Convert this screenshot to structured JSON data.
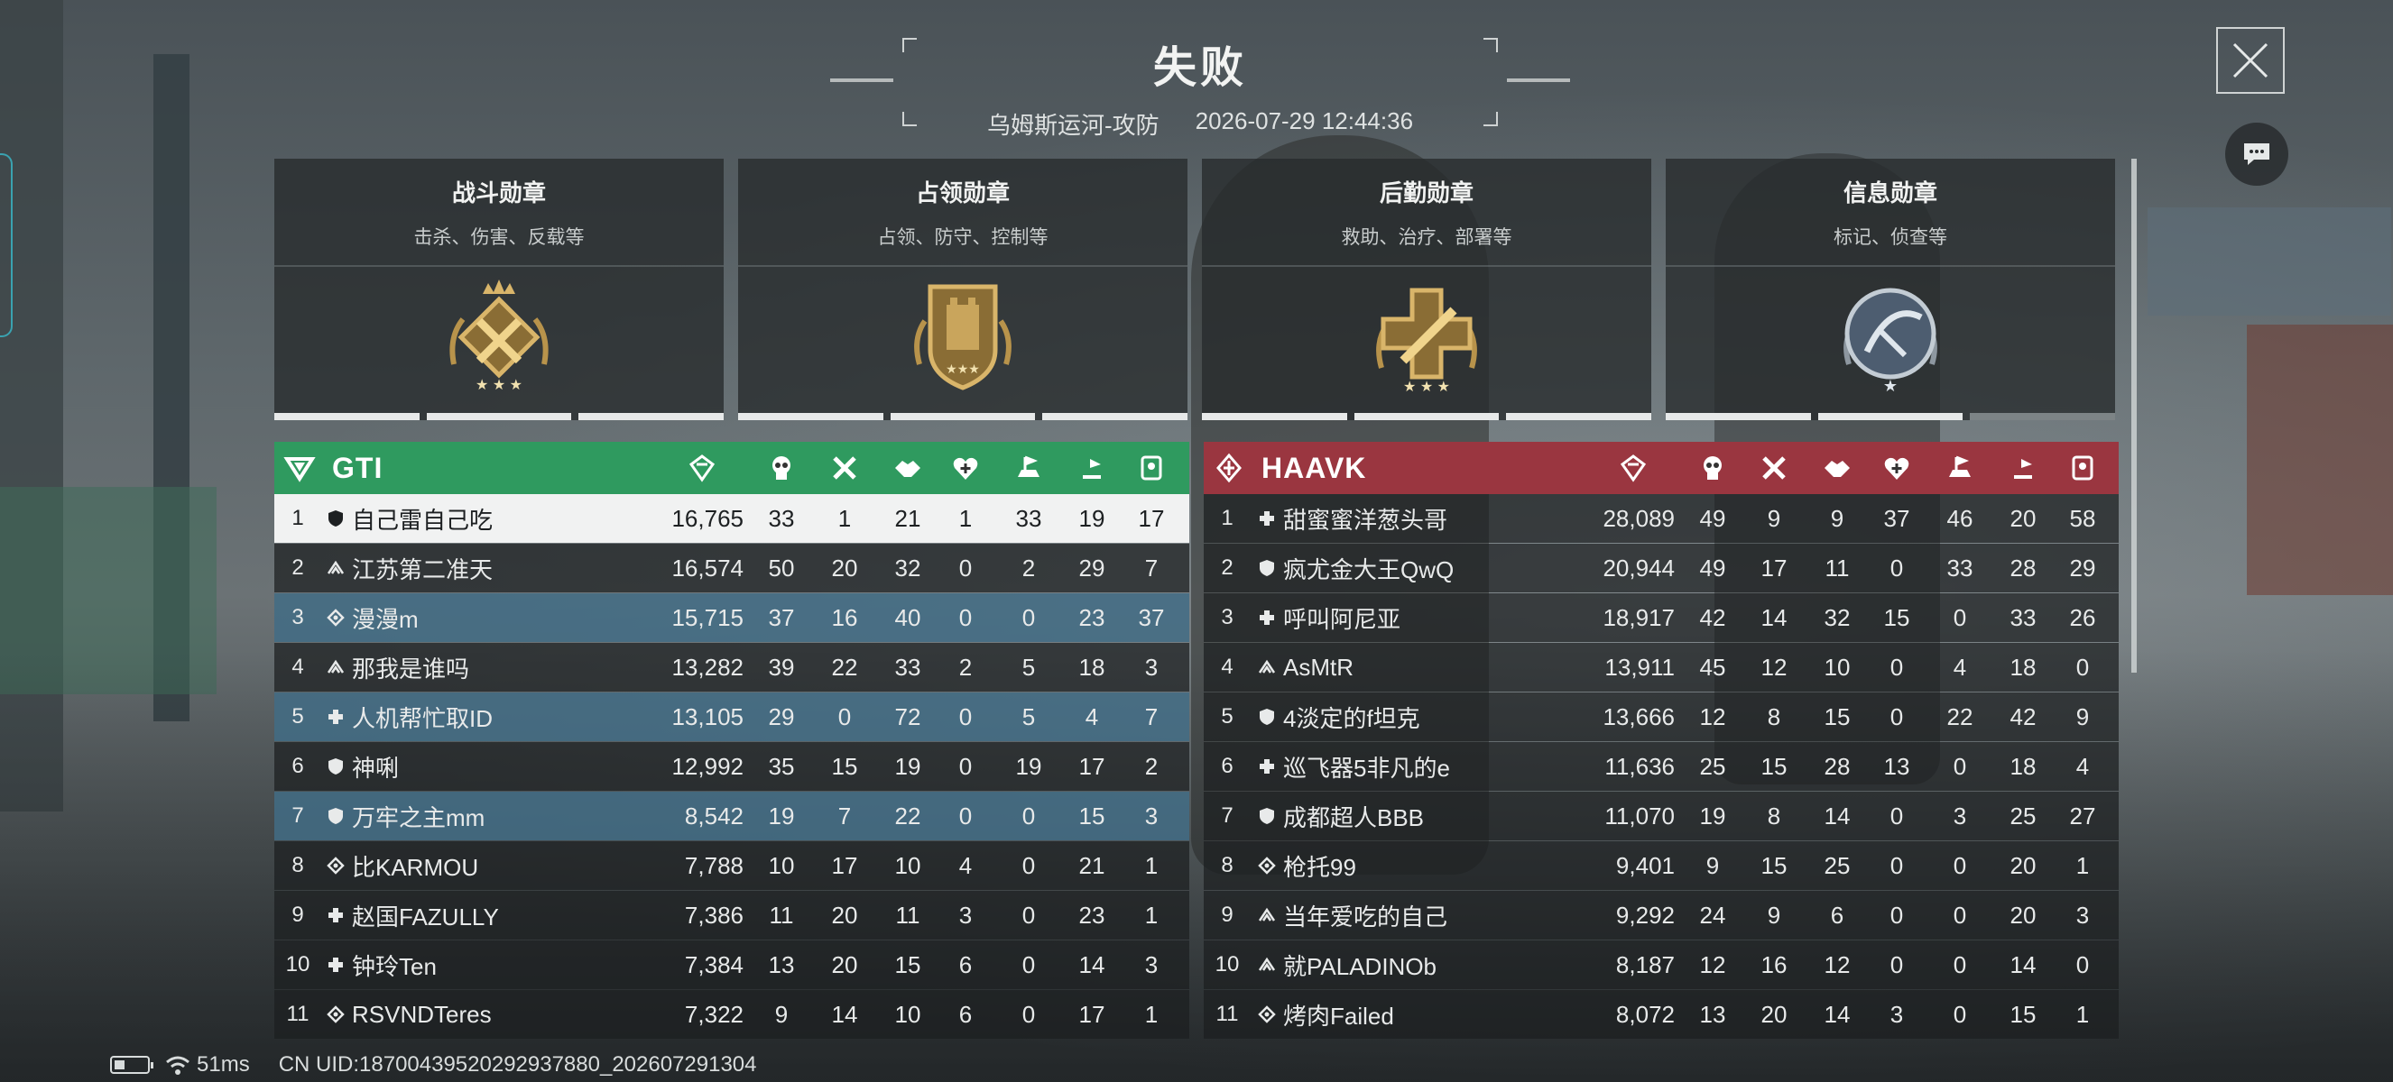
{
  "header": {
    "title": "失败",
    "map_mode": "乌姆斯运河-攻防",
    "datetime": "2026-07-29 12:44:36"
  },
  "buttons": {
    "close_icon": "close-icon",
    "chat_icon": "chat-icon"
  },
  "medals": [
    {
      "name": "战斗勋章",
      "desc": "击杀、伤害、反载等",
      "icon": "combat-medal-icon",
      "progress_segments": 3,
      "filled_segments": 3
    },
    {
      "name": "占领勋章",
      "desc": "占领、防守、控制等",
      "icon": "capture-medal-icon",
      "progress_segments": 3,
      "filled_segments": 3
    },
    {
      "name": "后勤勋章",
      "desc": "救助、治疗、部署等",
      "icon": "logistics-medal-icon",
      "progress_segments": 3,
      "filled_segments": 3
    },
    {
      "name": "信息勋章",
      "desc": "标记、侦查等",
      "icon": "intel-medal-icon",
      "progress_segments": 3,
      "filled_segments": 2
    }
  ],
  "columns": [
    "score-icon",
    "kills-icon",
    "deaths-icon",
    "assists-icon",
    "revives-icon",
    "capture-icon",
    "objective-icon",
    "intel-icon"
  ],
  "teams": {
    "left": {
      "name": "GTI",
      "color": "#2f9a5f",
      "rows": [
        {
          "rank": "1",
          "cls": "shield",
          "name": "自己雷自己吃",
          "score": "16,765",
          "stats": [
            "33",
            "1",
            "21",
            "1",
            "33",
            "19",
            "17"
          ],
          "state": "me"
        },
        {
          "rank": "2",
          "cls": "recon",
          "name": "江苏第二准天",
          "score": "16,574",
          "stats": [
            "50",
            "20",
            "32",
            "0",
            "2",
            "29",
            "7"
          ],
          "state": ""
        },
        {
          "rank": "3",
          "cls": "engineer",
          "name": "漫漫m",
          "score": "15,715",
          "stats": [
            "37",
            "16",
            "40",
            "0",
            "0",
            "23",
            "37"
          ],
          "state": "party"
        },
        {
          "rank": "4",
          "cls": "recon",
          "name": "那我是谁吗",
          "score": "13,282",
          "stats": [
            "39",
            "22",
            "33",
            "2",
            "5",
            "18",
            "3"
          ],
          "state": ""
        },
        {
          "rank": "5",
          "cls": "medic",
          "name": "人机帮忙取ID",
          "score": "13,105",
          "stats": [
            "29",
            "0",
            "72",
            "0",
            "5",
            "4",
            "7"
          ],
          "state": "party"
        },
        {
          "rank": "6",
          "cls": "shield",
          "name": "神唎",
          "score": "12,992",
          "stats": [
            "35",
            "15",
            "19",
            "0",
            "19",
            "17",
            "2"
          ],
          "state": ""
        },
        {
          "rank": "7",
          "cls": "shield",
          "name": "万牢之主mm",
          "score": "8,542",
          "stats": [
            "19",
            "7",
            "22",
            "0",
            "0",
            "15",
            "3"
          ],
          "state": "party"
        },
        {
          "rank": "8",
          "cls": "engineer",
          "name": "比KARMOU",
          "score": "7,788",
          "stats": [
            "10",
            "17",
            "10",
            "4",
            "0",
            "21",
            "1"
          ],
          "state": ""
        },
        {
          "rank": "9",
          "cls": "medic",
          "name": "赵国FAZULLY",
          "score": "7,386",
          "stats": [
            "11",
            "20",
            "11",
            "3",
            "0",
            "23",
            "1"
          ],
          "state": ""
        },
        {
          "rank": "10",
          "cls": "medic",
          "name": "钟玲Ten",
          "score": "7,384",
          "stats": [
            "13",
            "20",
            "15",
            "6",
            "0",
            "14",
            "3"
          ],
          "state": ""
        },
        {
          "rank": "11",
          "cls": "engineer",
          "name": "RSVNDTeres",
          "score": "7,322",
          "stats": [
            "9",
            "14",
            "10",
            "6",
            "0",
            "17",
            "1"
          ],
          "state": ""
        }
      ]
    },
    "right": {
      "name": "HAAVK",
      "color": "#9a3640",
      "rows": [
        {
          "rank": "1",
          "cls": "medic",
          "name": "甜蜜蜜洋葱头哥",
          "score": "28,089",
          "stats": [
            "49",
            "9",
            "9",
            "37",
            "46",
            "20",
            "58"
          ],
          "state": ""
        },
        {
          "rank": "2",
          "cls": "shield",
          "name": "疯尤金大王QwQ",
          "score": "20,944",
          "stats": [
            "49",
            "17",
            "11",
            "0",
            "33",
            "28",
            "29"
          ],
          "state": ""
        },
        {
          "rank": "3",
          "cls": "medic",
          "name": "呼叫阿尼亚",
          "score": "18,917",
          "stats": [
            "42",
            "14",
            "32",
            "15",
            "0",
            "33",
            "26"
          ],
          "state": ""
        },
        {
          "rank": "4",
          "cls": "recon",
          "name": "AsMtR",
          "score": "13,911",
          "stats": [
            "45",
            "12",
            "10",
            "0",
            "4",
            "18",
            "0"
          ],
          "state": ""
        },
        {
          "rank": "5",
          "cls": "shield",
          "name": "4淡定的f坦克",
          "score": "13,666",
          "stats": [
            "12",
            "8",
            "15",
            "0",
            "22",
            "42",
            "9"
          ],
          "state": ""
        },
        {
          "rank": "6",
          "cls": "medic",
          "name": "巡飞器5非凡的e",
          "score": "11,636",
          "stats": [
            "25",
            "15",
            "28",
            "13",
            "0",
            "18",
            "4"
          ],
          "state": ""
        },
        {
          "rank": "7",
          "cls": "shield",
          "name": "成都超人BBB",
          "score": "11,070",
          "stats": [
            "19",
            "8",
            "14",
            "0",
            "3",
            "25",
            "27"
          ],
          "state": ""
        },
        {
          "rank": "8",
          "cls": "engineer",
          "name": "枪托99",
          "score": "9,401",
          "stats": [
            "9",
            "15",
            "25",
            "0",
            "0",
            "20",
            "1"
          ],
          "state": ""
        },
        {
          "rank": "9",
          "cls": "recon",
          "name": "当年爱吃的自己",
          "score": "9,292",
          "stats": [
            "24",
            "9",
            "6",
            "0",
            "0",
            "20",
            "3"
          ],
          "state": ""
        },
        {
          "rank": "10",
          "cls": "recon",
          "name": "就PALADINOb",
          "score": "8,187",
          "stats": [
            "12",
            "16",
            "12",
            "0",
            "0",
            "14",
            "0"
          ],
          "state": ""
        },
        {
          "rank": "11",
          "cls": "engineer",
          "name": "烤肉Failed",
          "score": "8,072",
          "stats": [
            "13",
            "20",
            "14",
            "3",
            "0",
            "15",
            "1"
          ],
          "state": ""
        }
      ]
    }
  },
  "footer": {
    "ping": "51ms",
    "uid": "CN UID:18700439520292937880_202607291304",
    "battery_level": 0.3
  }
}
